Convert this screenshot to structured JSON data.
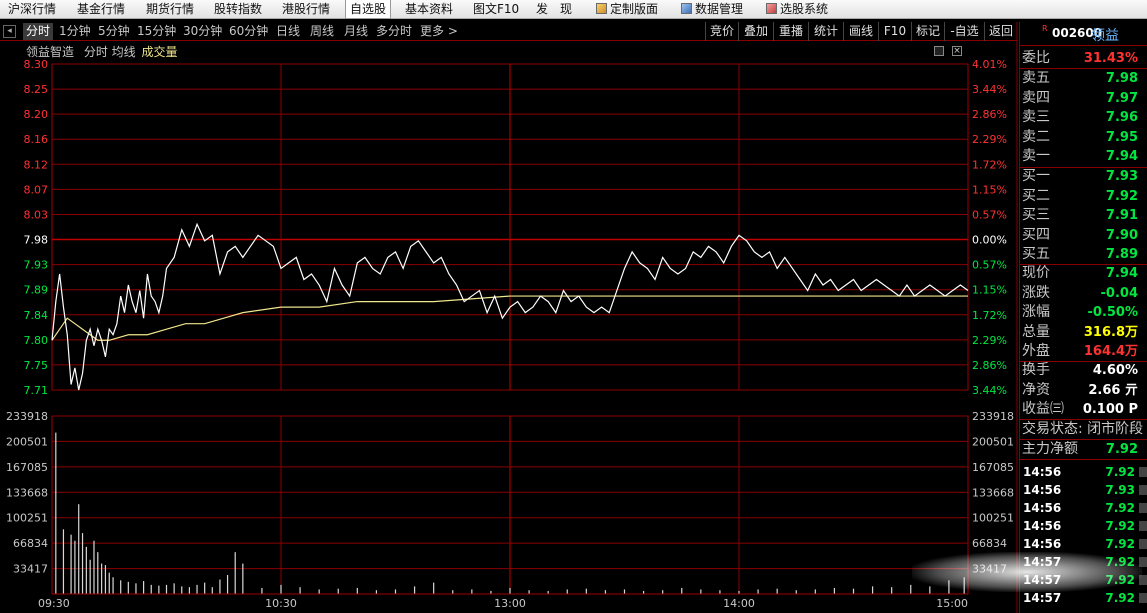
{
  "topbar": {
    "items": [
      {
        "label": "沪深行情",
        "x": 8
      },
      {
        "label": "基金行情",
        "x": 77
      },
      {
        "label": "期货行情",
        "x": 146
      },
      {
        "label": "股转指数",
        "x": 214
      },
      {
        "label": "港股行情",
        "x": 282
      },
      {
        "label": "自选股",
        "x": 345,
        "active": true
      },
      {
        "label": "基本资料",
        "x": 405
      },
      {
        "label": "图文F10",
        "x": 473
      },
      {
        "label": "发　现",
        "x": 536
      }
    ],
    "tools": [
      {
        "label": "定制版面",
        "x": 596,
        "icon": "layout-icon"
      },
      {
        "label": "数据管理",
        "x": 681,
        "icon": "database-icon"
      },
      {
        "label": "选股系统",
        "x": 766,
        "icon": "stock-picker-icon"
      }
    ]
  },
  "tabbar": {
    "tabs": [
      {
        "label": "分时",
        "x": 26,
        "selected": true
      },
      {
        "label": "1分钟",
        "x": 59
      },
      {
        "label": "5分钟",
        "x": 98
      },
      {
        "label": "15分钟",
        "x": 137
      },
      {
        "label": "30分钟",
        "x": 183
      },
      {
        "label": "60分钟",
        "x": 229
      },
      {
        "label": "日线",
        "x": 276
      },
      {
        "label": "周线",
        "x": 310
      },
      {
        "label": "月线",
        "x": 344
      },
      {
        "label": "多分时",
        "x": 376
      },
      {
        "label": "更多 >",
        "x": 420
      }
    ],
    "right_buttons": [
      {
        "label": "竞价",
        "x": 705,
        "w": 33
      },
      {
        "label": "叠加",
        "x": 738,
        "w": 35
      },
      {
        "label": "重播",
        "x": 773,
        "w": 35
      },
      {
        "label": "统计",
        "x": 808,
        "w": 35
      },
      {
        "label": "画线",
        "x": 843,
        "w": 35
      },
      {
        "label": "F10",
        "x": 878,
        "w": 33
      },
      {
        "label": "标记",
        "x": 911,
        "w": 33
      },
      {
        "label": "-自选",
        "x": 944,
        "w": 40
      },
      {
        "label": "返回",
        "x": 984,
        "w": 33
      }
    ]
  },
  "info": {
    "name": "领益智造",
    "mode": "分时 均线",
    "volume_label": "成交量"
  },
  "chart_data": {
    "type": "line",
    "price_axis": [
      "8.30",
      "8.25",
      "8.20",
      "8.16",
      "8.12",
      "8.07",
      "8.03",
      "7.98",
      "7.93",
      "7.89",
      "7.84",
      "7.80",
      "7.75",
      "7.71"
    ],
    "pct_axis": [
      "4.01%",
      "3.44%",
      "2.86%",
      "2.29%",
      "1.72%",
      "1.15%",
      "0.57%",
      "0.00%",
      "0.57%",
      "1.15%",
      "1.72%",
      "2.29%",
      "2.86%",
      "3.44%"
    ],
    "pct_colors": [
      "#ff3232",
      "#ff3232",
      "#ff3232",
      "#ff3232",
      "#ff3232",
      "#ff3232",
      "#ff3232",
      "#ffffff",
      "#00e640",
      "#00e640",
      "#00e640",
      "#00e640",
      "#00e640",
      "#00e640"
    ],
    "ylim": [
      7.71,
      8.3
    ],
    "prev_close": 7.98,
    "volume_axis": [
      "233918",
      "200501",
      "167085",
      "133668",
      "100251",
      "66834",
      "33417"
    ],
    "volume_max": 233918,
    "time_labels": [
      "09:30",
      "10:30",
      "13:00",
      "14:00",
      "15:00"
    ],
    "price_series": {
      "name": "",
      "x": [
        0,
        1,
        2,
        3,
        4,
        5,
        6,
        7,
        8,
        9,
        10,
        11,
        12,
        13,
        14,
        15,
        16,
        17,
        18,
        19,
        20,
        21,
        22,
        23,
        24,
        25,
        26,
        27,
        28,
        29,
        30,
        32,
        34,
        36,
        38,
        40,
        42,
        44,
        46,
        48,
        50,
        52,
        54,
        56,
        58,
        60,
        62,
        64,
        66,
        68,
        70,
        72,
        74,
        76,
        78,
        80,
        82,
        84,
        86,
        88,
        90,
        92,
        94,
        96,
        98,
        100,
        102,
        104,
        106,
        108,
        110,
        112,
        114,
        116,
        118,
        120,
        122,
        124,
        126,
        128,
        130,
        132,
        134,
        136,
        138,
        140,
        142,
        144,
        146,
        148,
        150,
        152,
        154,
        156,
        158,
        160,
        162,
        164,
        166,
        168,
        170,
        172,
        174,
        176,
        178,
        180,
        182,
        184,
        186,
        188,
        190,
        192,
        194,
        196,
        198,
        200,
        202,
        204,
        206,
        208,
        210,
        212,
        214,
        216,
        218,
        220,
        222,
        224,
        226,
        228,
        230,
        232,
        234,
        236,
        238,
        240
      ],
      "values": [
        7.8,
        7.87,
        7.92,
        7.86,
        7.81,
        7.72,
        7.75,
        7.71,
        7.74,
        7.8,
        7.82,
        7.79,
        7.82,
        7.8,
        7.77,
        7.82,
        7.81,
        7.83,
        7.88,
        7.85,
        7.9,
        7.87,
        7.85,
        7.89,
        7.84,
        7.92,
        7.88,
        7.87,
        7.85,
        7.88,
        7.93,
        7.95,
        8.0,
        7.97,
        8.01,
        7.98,
        7.99,
        7.92,
        7.96,
        7.97,
        7.95,
        7.97,
        7.99,
        7.98,
        7.97,
        7.93,
        7.94,
        7.95,
        7.91,
        7.92,
        7.9,
        7.87,
        7.93,
        7.9,
        7.88,
        7.94,
        7.95,
        7.93,
        7.92,
        7.95,
        7.96,
        7.93,
        7.97,
        7.98,
        7.96,
        7.94,
        7.95,
        7.92,
        7.9,
        7.87,
        7.88,
        7.89,
        7.85,
        7.88,
        7.84,
        7.86,
        7.87,
        7.85,
        7.86,
        7.88,
        7.87,
        7.85,
        7.89,
        7.87,
        7.88,
        7.86,
        7.85,
        7.86,
        7.85,
        7.89,
        7.93,
        7.96,
        7.94,
        7.93,
        7.91,
        7.95,
        7.93,
        7.92,
        7.93,
        7.96,
        7.95,
        7.97,
        7.96,
        7.94,
        7.97,
        7.99,
        7.98,
        7.96,
        7.95,
        7.96,
        7.93,
        7.95,
        7.93,
        7.91,
        7.89,
        7.92,
        7.9,
        7.91,
        7.89,
        7.9,
        7.91,
        7.89,
        7.9,
        7.91,
        7.9,
        7.89,
        7.88,
        7.9,
        7.88,
        7.89,
        7.9,
        7.89,
        7.88,
        7.89,
        7.9,
        7.89,
        7.88
      ],
      "color": "#ffffff"
    },
    "avg_series": {
      "name": "",
      "x": [
        0,
        2,
        4,
        6,
        8,
        10,
        12,
        15,
        20,
        25,
        30,
        35,
        40,
        45,
        50,
        60,
        70,
        80,
        90,
        100,
        120,
        140,
        160,
        180,
        200,
        220,
        240
      ],
      "values": [
        7.8,
        7.82,
        7.84,
        7.83,
        7.82,
        7.81,
        7.8,
        7.8,
        7.81,
        7.81,
        7.82,
        7.83,
        7.83,
        7.84,
        7.85,
        7.86,
        7.86,
        7.87,
        7.87,
        7.87,
        7.88,
        7.88,
        7.88,
        7.88,
        7.88,
        7.88,
        7.88
      ],
      "color": "#f0e68c"
    },
    "volume_series": {
      "x": [
        1,
        3,
        5,
        6,
        7,
        8,
        9,
        10,
        11,
        12,
        13,
        14,
        15,
        16,
        18,
        20,
        22,
        24,
        26,
        28,
        30,
        32,
        34,
        36,
        38,
        40,
        42,
        44,
        46,
        48,
        50,
        55,
        60,
        65,
        70,
        75,
        80,
        85,
        90,
        95,
        100,
        105,
        110,
        115,
        120,
        125,
        130,
        135,
        140,
        145,
        150,
        155,
        160,
        165,
        170,
        175,
        180,
        185,
        190,
        195,
        200,
        205,
        210,
        215,
        220,
        225,
        230,
        235,
        239
      ],
      "values": [
        212000,
        85000,
        78000,
        70000,
        118000,
        80000,
        62000,
        45000,
        70000,
        55000,
        40000,
        38000,
        28000,
        22000,
        18000,
        16000,
        14000,
        17000,
        12000,
        11000,
        12000,
        14000,
        10000,
        9000,
        12000,
        15000,
        9000,
        19000,
        25000,
        55000,
        40000,
        8000,
        12000,
        9000,
        6000,
        7000,
        8000,
        5000,
        6000,
        10000,
        15000,
        5000,
        6000,
        4000,
        8000,
        5000,
        4000,
        6000,
        7000,
        5000,
        6000,
        4000,
        5000,
        8000,
        6000,
        5000,
        4000,
        6000,
        7000,
        5000,
        6000,
        8000,
        7000,
        10000,
        9000,
        12000,
        10000,
        18000,
        22000
      ]
    }
  },
  "panel": {
    "code": "002600",
    "r_mark": "R",
    "name": "领益",
    "weibi": {
      "label": "委比",
      "value": "31.43%"
    },
    "asks": [
      {
        "label": "卖五",
        "price": "7.98"
      },
      {
        "label": "卖四",
        "price": "7.97"
      },
      {
        "label": "卖三",
        "price": "7.96"
      },
      {
        "label": "卖二",
        "price": "7.95"
      },
      {
        "label": "卖一",
        "price": "7.94"
      }
    ],
    "bids": [
      {
        "label": "买一",
        "price": "7.93"
      },
      {
        "label": "买二",
        "price": "7.92"
      },
      {
        "label": "买三",
        "price": "7.91"
      },
      {
        "label": "买四",
        "price": "7.90"
      },
      {
        "label": "买五",
        "price": "7.89"
      }
    ],
    "stats": [
      {
        "label": "现价",
        "value": "7.94",
        "color": "#00e640"
      },
      {
        "label": "涨跌",
        "value": "-0.04",
        "color": "#00e640"
      },
      {
        "label": "涨幅",
        "value": "-0.50%",
        "color": "#00e640"
      },
      {
        "label": "总量",
        "value": "316.8万",
        "color": "#ffff00"
      },
      {
        "label": "外盘",
        "value": "164.4万",
        "color": "#ff3232"
      }
    ],
    "stats2": [
      {
        "label": "换手",
        "value": "4.60%",
        "color": "#ffffff"
      },
      {
        "label": "净资",
        "value": "2.66 亓",
        "color": "#ffffff"
      },
      {
        "label": "收益㈢",
        "value": "0.100 P",
        "color": "#ffffff"
      }
    ],
    "trade_status": "交易状态: 闭市阶段",
    "main_flow_label": "主力净额",
    "main_flow_value": "7.92",
    "ticks": [
      {
        "time": "14:56",
        "price": "7.92"
      },
      {
        "time": "14:56",
        "price": "7.93"
      },
      {
        "time": "14:56",
        "price": "7.92"
      },
      {
        "time": "14:56",
        "price": "7.92"
      },
      {
        "time": "14:56",
        "price": "7.92"
      },
      {
        "time": "14:57",
        "price": "7.92"
      },
      {
        "time": "14:57",
        "price": "7.92"
      },
      {
        "time": "14:57",
        "price": "7.92"
      }
    ]
  }
}
